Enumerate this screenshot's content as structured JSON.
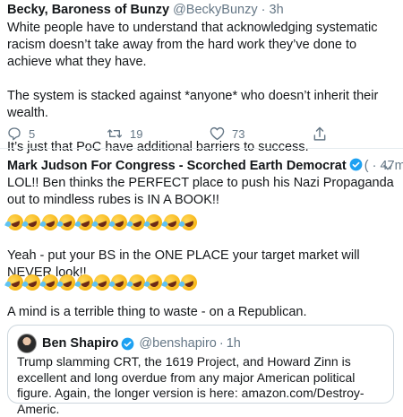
{
  "tweet1": {
    "name": "Becky, Baroness of Bunzy",
    "handle": "@BeckyBunzy",
    "time": "3h",
    "paragraphs": [
      "White people have to understand that acknowledging systematic racism doesn’t take away from the hard work they’ve done to achieve what they have.",
      "The system is stacked against *anyone* who doesn’t inherit their wealth.",
      "It’s just that PoC have additional barriers to success."
    ],
    "replies": "5",
    "retweets": "19",
    "likes": "73"
  },
  "tweet2": {
    "name": "Mark Judson For Congress - Scorched Earth Democrat",
    "handle": "(",
    "time": "47m",
    "line1": "LOL!! Ben thinks the PERFECT place to push his Nazi Propaganda out to mindless rubes is IN A BOOK!!",
    "line2": "Yeah - put your BS in the ONE PLACE your target market will NEVER look!!",
    "line3": "A mind is a terrible thing to waste - on a Republican.",
    "emoji_name": "rolling-on-floor-laughing",
    "emoji_count": 11
  },
  "quote": {
    "name": "Ben Shapiro",
    "handle": "@benshapiro",
    "time": "1h",
    "text": "Trump slamming CRT, the 1619 Project, and Howard Zinn is excellent and long overdue from any major American political figure. Again, the longer version is here: amazon.com/Destroy-Americ."
  },
  "colors": {
    "text": "#14171a",
    "muted": "#657786",
    "verified": "#1da1f2",
    "border": "#ccd6dd"
  }
}
